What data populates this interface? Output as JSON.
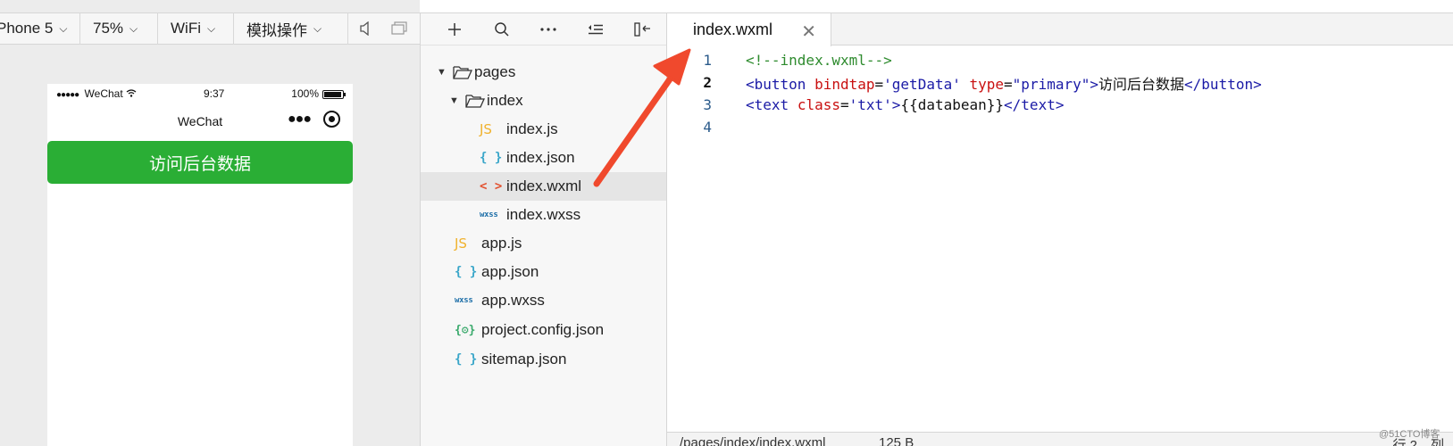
{
  "simulator": {
    "toolbar": {
      "device": "Phone 5",
      "zoom": "75%",
      "network": "WiFi",
      "simulate": "模拟操作"
    },
    "phone": {
      "carrier": "WeChat",
      "time": "9:37",
      "battery": "100%",
      "nav_title": "WeChat",
      "button_label": "访问后台数据"
    }
  },
  "file_tree": {
    "folder_pages": "pages",
    "folder_index": "index",
    "files": {
      "index_js": "index.js",
      "index_json": "index.json",
      "index_wxml": "index.wxml",
      "index_wxss": "index.wxss",
      "app_js": "app.js",
      "app_json": "app.json",
      "app_wxss": "app.wxss",
      "project_config": "project.config.json",
      "sitemap": "sitemap.json"
    },
    "icon_labels": {
      "js": "JS",
      "json": "{ }",
      "wxml": "< >",
      "wxss": "wxss",
      "config": "{⚙}"
    }
  },
  "editor": {
    "tab_title": "index.wxml",
    "line_numbers": [
      "1",
      "2",
      "3",
      "4"
    ],
    "line1": {
      "comment": "<!--index.wxml-->"
    },
    "line2": {
      "open": "<button",
      "attr1": "bindtap",
      "eq1": "=",
      "val1": "'getData'",
      "attr2": "type",
      "eq2": "=",
      "val2": "\"primary\"",
      "gt": ">",
      "text": "访问后台数据",
      "close": "</button>"
    },
    "line3": {
      "open": "<text",
      "attr1": "class",
      "eq1": "=",
      "val1": "'txt'",
      "gt": ">",
      "text": "{{databean}}",
      "close": "</text>"
    },
    "status": {
      "path": "/pages/index/index.wxml",
      "size": "125 B",
      "position": "行 2，列"
    }
  },
  "watermark": "@51CTO博客",
  "colors": {
    "primary_button": "#2aae35",
    "arrow": "#f0492d",
    "comment": "#2e8b2e",
    "tag": "#1a1aa6",
    "attribute": "#c91010"
  }
}
